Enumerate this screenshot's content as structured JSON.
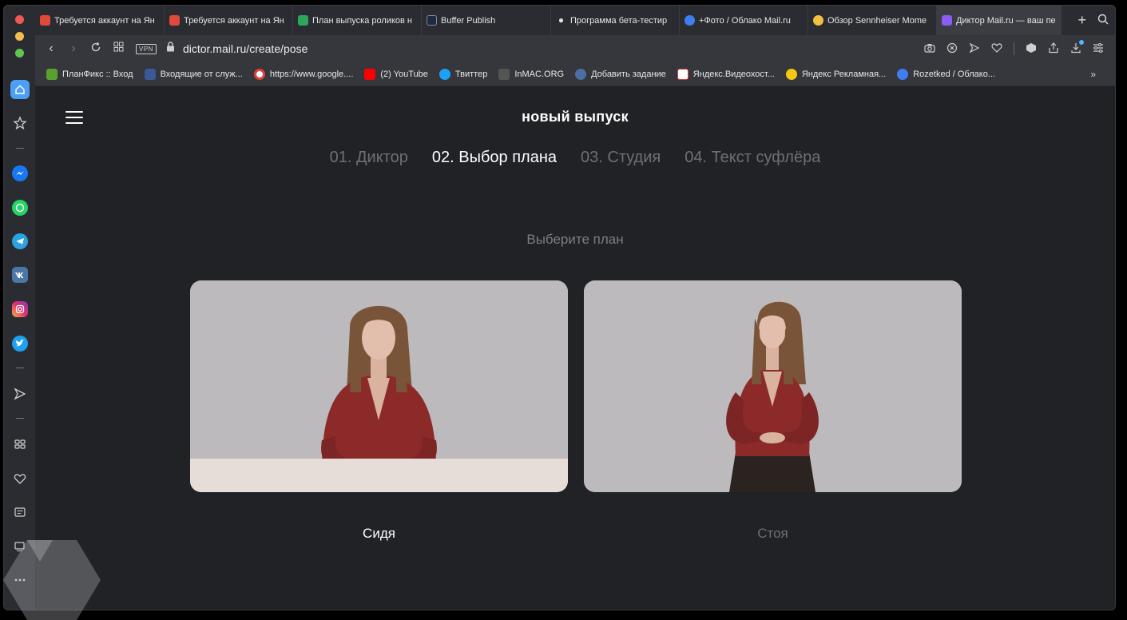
{
  "tabs": [
    {
      "label": "Требуется аккаунт на Ян",
      "color": "#e04a3a"
    },
    {
      "label": "Требуется аккаунт на Ян",
      "color": "#e04a3a"
    },
    {
      "label": "План выпуска роликов н",
      "color": "#2da65a"
    },
    {
      "label": "Buffer Publish",
      "color": "#1d2a44"
    },
    {
      "label": "Программа бета-тестир",
      "color": "#dddddd"
    },
    {
      "label": "+Фото / Облако Mail.ru",
      "color": "#3f7ef0"
    },
    {
      "label": "Обзор Sennheiser Mome",
      "color": "#f0c040"
    },
    {
      "label": "Диктор Mail.ru — ваш пе",
      "color": "#8b5cf6"
    }
  ],
  "address": {
    "vpn": "VPN",
    "url": "dictor.mail.ru/create/pose"
  },
  "bookmarks": [
    {
      "label": "ПланФикс :: Вход",
      "color": "#5aa02c"
    },
    {
      "label": "Входящие от служ...",
      "color": "#3b5998"
    },
    {
      "label": "https://www.google....",
      "color": "#e0403a"
    },
    {
      "label": "(2) YouTube",
      "color": "#ff0000"
    },
    {
      "label": "Твиттер",
      "color": "#1da1f2"
    },
    {
      "label": "InMAC.ORG",
      "color": "#555555"
    },
    {
      "label": "Добавить задание",
      "color": "#4a6fa5"
    },
    {
      "label": "Яндекс.Видеохост...",
      "color": "#ffffff"
    },
    {
      "label": "Яндекс Рекламная...",
      "color": "#f2c811"
    },
    {
      "label": "Rozetked / Облако...",
      "color": "#3f7ef0"
    }
  ],
  "page": {
    "title": "новый выпуск",
    "steps": [
      {
        "label": "01. Диктор",
        "active": false
      },
      {
        "label": "02. Выбор плана",
        "active": true
      },
      {
        "label": "03. Студия",
        "active": false
      },
      {
        "label": "04. Текст суфлёра",
        "active": false
      }
    ],
    "subtitle": "Выберите план",
    "options": [
      {
        "label": "Сидя",
        "selected": true
      },
      {
        "label": "Стоя",
        "selected": false
      }
    ]
  },
  "colors": {
    "accent": "#4d9ff5",
    "background": "#202226",
    "sweater": "#8c2a2a"
  }
}
